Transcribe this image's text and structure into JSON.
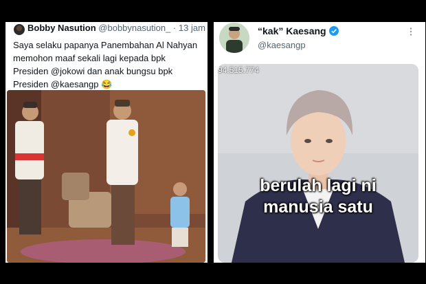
{
  "left_tweet": {
    "display_name": "Bobby Nasution",
    "handle": "@bobbynasution_",
    "separator": "·",
    "time": "13 jam",
    "text_lines": [
      "Saya selaku papanya Panembahan Al Nahyan",
      "memohon maaf sekali lagi kepada bpk",
      "Presiden @jokowi dan anak bungsu bpk",
      "Presiden @kaesangp 😂"
    ]
  },
  "right_tweet": {
    "display_name": "“kak” Kaesang",
    "handle": "@kaesangp",
    "more_icon": "more-vertical-icon",
    "verified_icon": "verified-badge-icon",
    "verified_color": "#1d9bf0",
    "counter_text": "94.515.774",
    "meme_lines": [
      "berulah lagi ni",
      "manusia satu"
    ]
  }
}
